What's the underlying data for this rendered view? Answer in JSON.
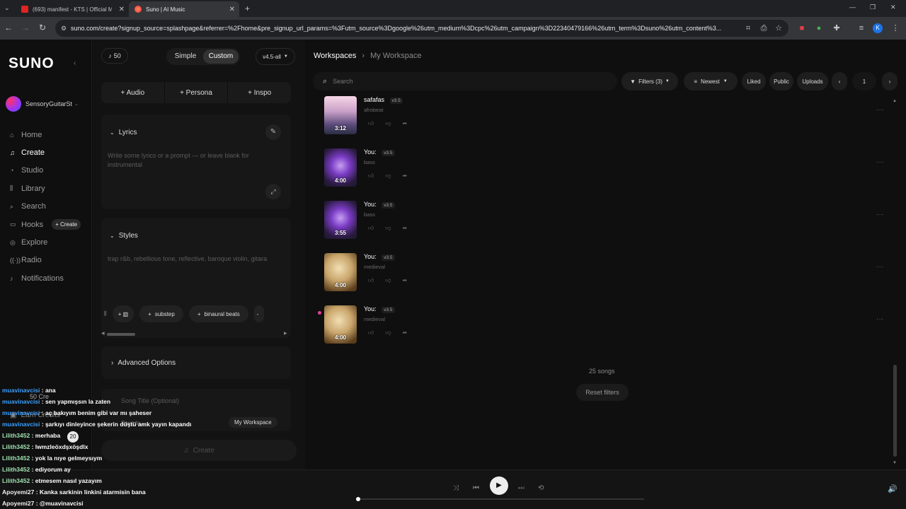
{
  "browser": {
    "tabs": [
      {
        "title": "(693) manifest - KTS | Official M",
        "active": false
      },
      {
        "title": "Suno | AI Music",
        "active": true
      }
    ],
    "new_tab": "+",
    "url": "suno.com/create?signup_source=splashpage&referrer=%2Fhome&pre_signup_url_params=%3Futm_source%3Dgoogle%26utm_medium%3Dcpc%26utm_campaign%3D22340479166%26utm_term%3Dsuno%26utm_content%3...",
    "profile_initial": "K"
  },
  "sidebar": {
    "logo": "SUNO",
    "username": "SensoryGuitarSt",
    "items": [
      {
        "label": "Home",
        "icon": "home-icon"
      },
      {
        "label": "Create",
        "icon": "create-icon",
        "active": true
      },
      {
        "label": "Studio",
        "icon": "studio-icon"
      },
      {
        "label": "Library",
        "icon": "library-icon"
      },
      {
        "label": "Search",
        "icon": "search-icon"
      },
      {
        "label": "Hooks",
        "icon": "hooks-icon",
        "pill": "+ Create"
      },
      {
        "label": "Explore",
        "icon": "explore-icon"
      },
      {
        "label": "Radio",
        "icon": "radio-icon"
      },
      {
        "label": "Notifications",
        "icon": "bell-icon"
      }
    ],
    "credits": "50 Cre",
    "earn": "Earn Credits",
    "badge": "20"
  },
  "create": {
    "credits": "50",
    "mode_simple": "Simple",
    "mode_custom": "Custom",
    "version": "v4.5-all",
    "add_audio": "+ Audio",
    "add_persona": "+ Persona",
    "add_inspo": "+ Inspo",
    "lyrics_heading": "Lyrics",
    "lyrics_placeholder": "Write some lyrics or a prompt — or leave blank for instrumental",
    "styles_heading": "Styles",
    "styles_placeholder": "trap r&b, rebellious tone, reflective, baroque violin, gitara",
    "tags": [
      "substep",
      "binaural beats"
    ],
    "advanced": "Advanced Options",
    "song_title_placeholder": "Song Title (Optional)",
    "save_to": "Save to...",
    "workspace": "My Workspace",
    "create_button": "Create"
  },
  "main": {
    "crumb_root": "Workspaces",
    "crumb_current": "My Workspace",
    "search_placeholder": "Search",
    "filters": "Filters (3)",
    "sort": "Newest",
    "liked": "Liked",
    "public": "Public",
    "uploads": "Uploads",
    "page": "1",
    "songs": [
      {
        "title": "safafas",
        "version": "v3.5",
        "genre": "afrobeat",
        "duration": "3:12",
        "thumb": "city"
      },
      {
        "title": "You:",
        "version": "v3.5",
        "genre": "bass",
        "duration": "4:00",
        "thumb": "heart"
      },
      {
        "title": "You:",
        "version": "v3.5",
        "genre": "bass",
        "duration": "3:55",
        "thumb": "heart"
      },
      {
        "title": "You:",
        "version": "v3.5",
        "genre": "medieval",
        "duration": "4:00",
        "thumb": "book"
      },
      {
        "title": "You:",
        "version": "v3.5",
        "genre": "medieval",
        "duration": "4:00",
        "thumb": "book"
      }
    ],
    "count": "25 songs",
    "reset": "Reset filters"
  },
  "chat": [
    {
      "user": "muavinavcisi",
      "msg": "ana"
    },
    {
      "user": "muavinavcisi",
      "msg": "sen yapmışsın la zaten"
    },
    {
      "user": "muavinavcisi",
      "msg": "aç bakıyım benim gibi var mı şaheser"
    },
    {
      "user": "muavinavcisi",
      "msg": "şarkıyı dinleyince şekerin düştü amk yayın kapandı"
    },
    {
      "user": "Lilith3452",
      "msg": "merhaba"
    },
    {
      "user": "Lilith3452",
      "msg": "lwmzleöxdşxöşdlx"
    },
    {
      "user": "Lilith3452",
      "msg": "yok la nıye gelmeysıym"
    },
    {
      "user": "Lilith3452",
      "msg": "ediyorum ay"
    },
    {
      "user": "Lilith3452",
      "msg": "etmesem nasıl yazayım"
    },
    {
      "user": "Apoyemi27",
      "msg": "Kanka sarkinin linkini atarmisin bana"
    },
    {
      "user": "Apoyemi27",
      "msg": "@muavinavcisi"
    }
  ],
  "colors": {
    "accent_pink": "#e0409a",
    "chat_blue": "#3aa0ff",
    "chat_green": "#9ee0b0"
  }
}
